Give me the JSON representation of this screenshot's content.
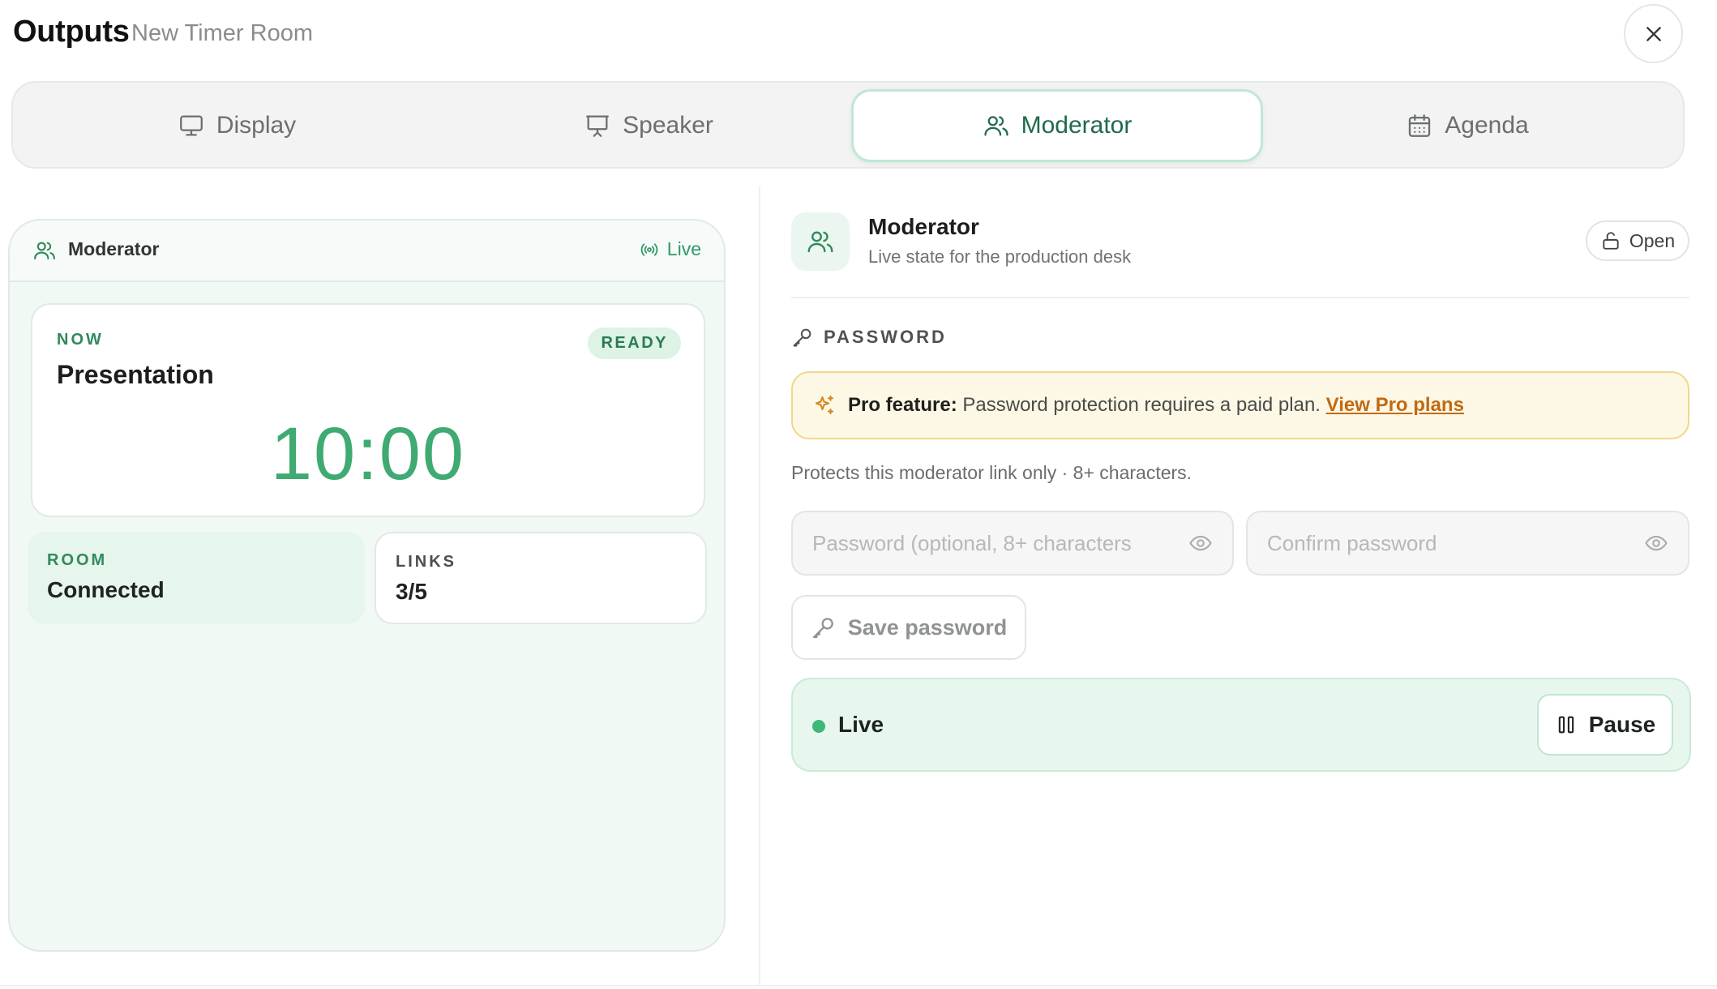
{
  "header": {
    "title": "Outputs",
    "subtitle": "New Timer Room"
  },
  "tabs": [
    {
      "label": "Display",
      "icon": "monitor-icon",
      "active": false
    },
    {
      "label": "Speaker",
      "icon": "presentation-icon",
      "active": false
    },
    {
      "label": "Moderator",
      "icon": "users-icon",
      "active": true
    },
    {
      "label": "Agenda",
      "icon": "calendar-icon",
      "active": false
    }
  ],
  "preview": {
    "label": "Moderator",
    "live_label": "Live",
    "now_label": "NOW",
    "status_badge": "READY",
    "segment_title": "Presentation",
    "timer": "10:00",
    "room_label": "ROOM",
    "room_value": "Connected",
    "links_label": "LINKS",
    "links_value": "3/5"
  },
  "settings": {
    "title": "Moderator",
    "subtitle": "Live state for the production desk",
    "open_label": "Open",
    "password_heading": "PASSWORD",
    "pro_label": "Pro feature:",
    "pro_text": "Password protection requires a paid plan.",
    "pro_link": "View Pro plans",
    "help_text": "Protects this moderator link only · 8+ characters.",
    "password_placeholder": "Password (optional, 8+ characters",
    "confirm_placeholder": "Confirm password",
    "save_label": "Save password",
    "live_label": "Live",
    "pause_label": "Pause"
  },
  "colors": {
    "accent": "#3faa72",
    "accent_dark": "#1f6a4a",
    "pro_link": "#c06a12",
    "pro_bg": "#fdf8e6"
  }
}
